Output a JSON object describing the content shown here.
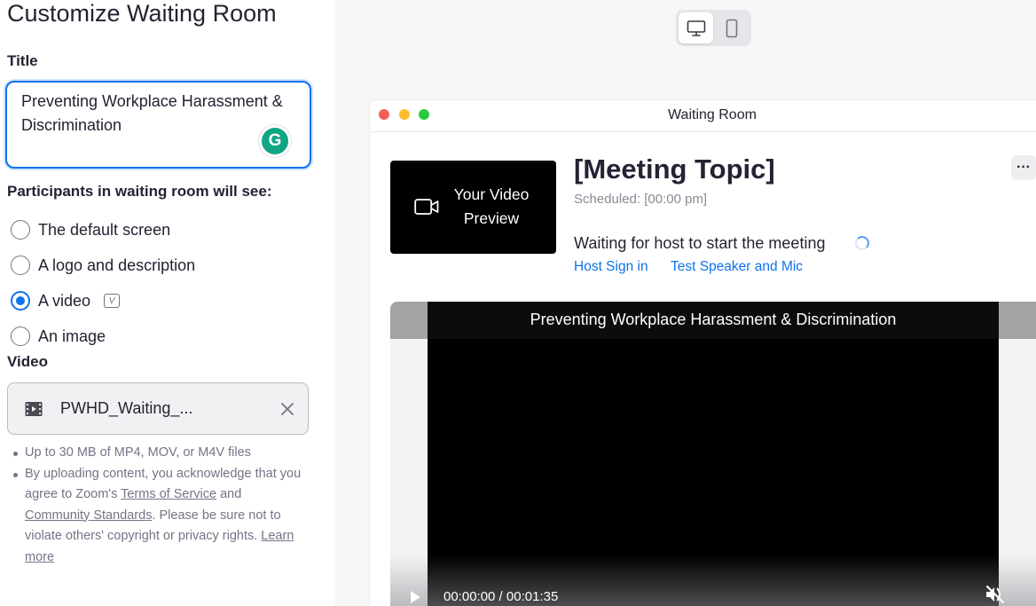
{
  "panel": {
    "heading": "Customize Waiting Room",
    "title_label": "Title",
    "title_value": "Preventing Workplace Harassment & Discrimination",
    "grammarly_letter": "G",
    "participants_label": "Participants in waiting room will see:",
    "options": [
      {
        "label": "The default screen",
        "selected": false
      },
      {
        "label": "A logo and description",
        "selected": false
      },
      {
        "label": "A video",
        "selected": true
      },
      {
        "label": "An image",
        "selected": false
      }
    ],
    "video_badge": "V",
    "video_label": "Video",
    "file_name": "PWHD_Waiting_...",
    "notes": {
      "note1": "Up to 30 MB of MP4, MOV, or M4V files",
      "note2_a": "By uploading content, you acknowledge that you agree to Zoom's ",
      "terms_link": "Terms of Service",
      "note2_b": " and ",
      "community_link": "Community Standards",
      "note2_c": ". Please be sure not to violate others' copyright or privacy rights. ",
      "learn_more_link": "Learn more"
    }
  },
  "device_toggle": {
    "selected": "desktop",
    "options": [
      "desktop",
      "mobile"
    ]
  },
  "preview": {
    "window_title": "Waiting Room",
    "video_preview_text": "Your Video Preview",
    "meeting_topic": "[Meeting Topic]",
    "scheduled": "Scheduled: [00:00 pm]",
    "waiting_text": "Waiting for host to start the meeting",
    "host_sign_in": "Host Sign in",
    "test_speaker": "Test Speaker and Mic",
    "more_label": "···",
    "player": {
      "title": "Preventing Workplace Harassment & Discrimination",
      "time": "00:00:00 / 00:01:35"
    }
  },
  "colors": {
    "accent": "#0e72ed",
    "traffic_red": "#f35f57",
    "traffic_yellow": "#febc2e",
    "traffic_green": "#29c840"
  }
}
